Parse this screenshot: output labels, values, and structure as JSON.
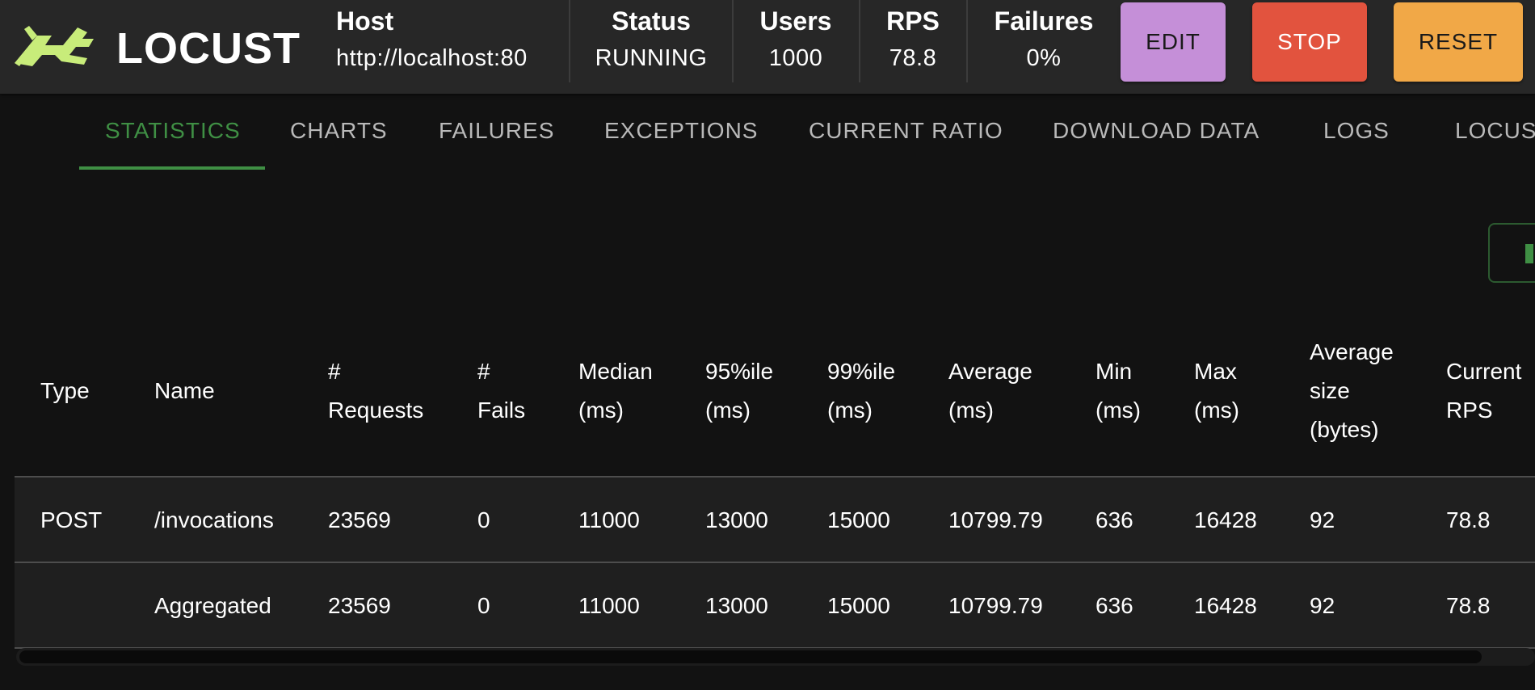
{
  "app": {
    "name": "LOCUST"
  },
  "header": {
    "host_label": "Host",
    "host_value": "http://localhost:80",
    "status_label": "Status",
    "status_value": "RUNNING",
    "users_label": "Users",
    "users_value": "1000",
    "rps_label": "RPS",
    "rps_value": "78.8",
    "failures_label": "Failures",
    "failures_value": "0%",
    "edit_label": "EDIT",
    "stop_label": "STOP",
    "reset_label": "RESET"
  },
  "tabs": [
    {
      "label": "STATISTICS",
      "active": true
    },
    {
      "label": "CHARTS"
    },
    {
      "label": "FAILURES"
    },
    {
      "label": "EXCEPTIONS"
    },
    {
      "label": "CURRENT RATIO"
    },
    {
      "label": "DOWNLOAD DATA"
    },
    {
      "label": "LOGS"
    },
    {
      "label": "LOCUS"
    }
  ],
  "table": {
    "headers": {
      "type": [
        "Type"
      ],
      "name": [
        "Name"
      ],
      "requests": [
        "#",
        "Requests"
      ],
      "fails": [
        "#",
        "Fails"
      ],
      "median": [
        "Median",
        "(ms)"
      ],
      "p95": [
        "95%ile",
        "(ms)"
      ],
      "p99": [
        "99%ile",
        "(ms)"
      ],
      "average": [
        "Average",
        "(ms)"
      ],
      "min": [
        "Min",
        "(ms)"
      ],
      "max": [
        "Max",
        "(ms)"
      ],
      "avg_size": [
        "Average",
        "size",
        "(bytes)"
      ],
      "current_rps": [
        "Current",
        "RPS"
      ]
    },
    "rows": [
      {
        "type": "POST",
        "name": "/invocations",
        "requests": "23569",
        "fails": "0",
        "median": "11000",
        "p95": "13000",
        "p99": "15000",
        "average": "10799.79",
        "min": "636",
        "max": "16428",
        "avg_size": "92",
        "current_rps": "78.8"
      },
      {
        "type": "",
        "name": "Aggregated",
        "requests": "23569",
        "fails": "0",
        "median": "11000",
        "p95": "13000",
        "p99": "15000",
        "average": "10799.79",
        "min": "636",
        "max": "16428",
        "avg_size": "92",
        "current_rps": "78.8"
      }
    ]
  },
  "colors": {
    "accent": "#3f8f44",
    "edit": "#c58fd8",
    "stop": "#e2533e",
    "reset": "#f1a847",
    "logo": "#c8ec7a"
  },
  "icons": {
    "logo": "locust-grasshopper-icon"
  }
}
